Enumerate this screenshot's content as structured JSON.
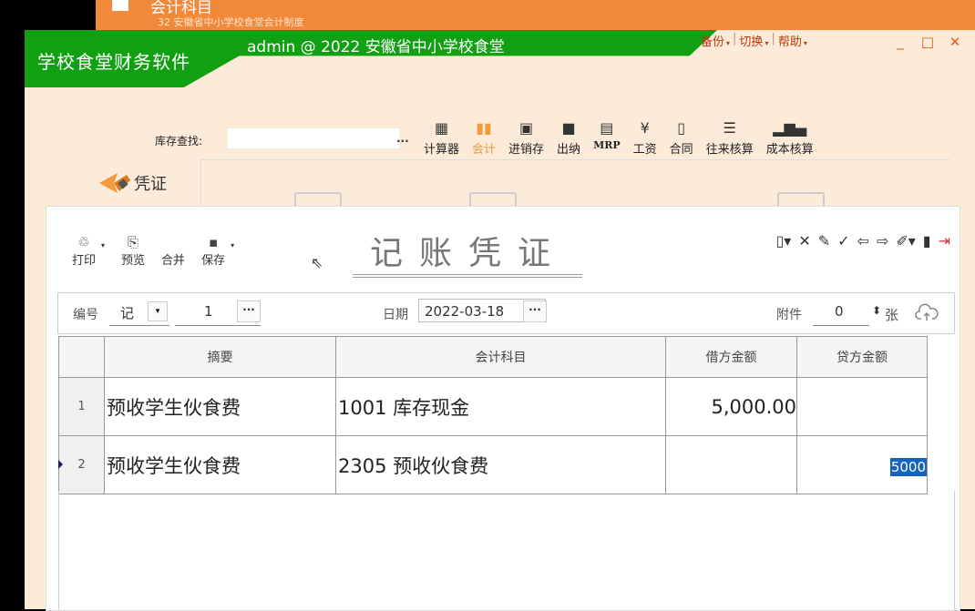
{
  "background_window": {
    "title": "会计科目",
    "subtitle": "32   安徽省中小学校食堂会计制度"
  },
  "app": {
    "name": "学校食堂财务软件",
    "account_title": "admin @ 2022 安徽省中小学校食堂",
    "menu": [
      {
        "label": "备份"
      },
      {
        "label": "切换"
      },
      {
        "label": "帮助"
      }
    ]
  },
  "search": {
    "label": "库存查找:",
    "value": "",
    "more": "..."
  },
  "modules": [
    {
      "label": "计算器",
      "icon": "calculator-icon",
      "glyph": "▦"
    },
    {
      "label": "会计",
      "icon": "book-icon",
      "glyph": "▮▮",
      "active": true
    },
    {
      "label": "进销存",
      "icon": "cart-icon",
      "glyph": "▣"
    },
    {
      "label": "出纳",
      "icon": "cashier-icon",
      "glyph": "■"
    },
    {
      "label": "MRP",
      "icon": "mrp-icon",
      "glyph": "▤"
    },
    {
      "label": "工资",
      "icon": "yen-icon",
      "glyph": "¥"
    },
    {
      "label": "合同",
      "icon": "document-icon",
      "glyph": "▯"
    },
    {
      "label": "往来核算",
      "icon": "list-icon",
      "glyph": "☰"
    },
    {
      "label": "成本核算",
      "icon": "bar-chart-icon",
      "glyph": "▂▆▄"
    }
  ],
  "side": {
    "voucher_label": "凭证"
  },
  "voucher": {
    "heading": "记账凭证",
    "toolbar": [
      {
        "label": "打印",
        "glyph": "♲",
        "icon": "print-icon",
        "caret": true
      },
      {
        "label": "预览",
        "glyph": "⎘",
        "icon": "preview-icon",
        "caret": false
      },
      {
        "label": "合并",
        "glyph": "",
        "icon": "merge-icon",
        "caret": false
      },
      {
        "label": "保存",
        "glyph": "▪",
        "icon": "save-icon",
        "caret": true
      }
    ],
    "right_tools": [
      {
        "glyph": "▯▾",
        "name": "new-icon"
      },
      {
        "glyph": "✕",
        "name": "delete-icon"
      },
      {
        "glyph": "✎",
        "name": "tools-icon"
      },
      {
        "glyph": "✓",
        "name": "check-icon"
      },
      {
        "glyph": "⇦",
        "name": "prev-icon"
      },
      {
        "glyph": "⇨",
        "name": "next-icon"
      },
      {
        "glyph": "✐▾",
        "name": "brush-icon"
      },
      {
        "glyph": "▮",
        "name": "clip-icon"
      },
      {
        "glyph": "⇥",
        "name": "exit-icon"
      }
    ],
    "number_label": "编号",
    "word": "记",
    "number": "1",
    "date_label": "日期",
    "date": "2022-03-18",
    "attach_label": "附件",
    "attach_count": "0",
    "attach_unit": "张",
    "columns": [
      "摘要",
      "会计科目",
      "借方金额",
      "贷方金额"
    ],
    "rows": [
      {
        "no": "1",
        "summary": "预收学生伙食费",
        "account": "1001 库存现金",
        "debit": "5,000.00",
        "credit": ""
      },
      {
        "no": "2",
        "summary": "预收学生伙食费",
        "account": "2305 预收伙食费",
        "debit": "",
        "credit": "5000"
      }
    ]
  },
  "colors": {
    "green": "#12a013",
    "orange": "#f08a3a",
    "window_bg": "#fcebd8",
    "selection": "#1565c0"
  }
}
